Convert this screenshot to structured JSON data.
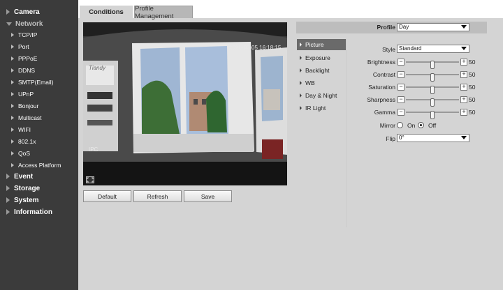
{
  "sidebar": {
    "camera": "Camera",
    "network": "Network",
    "items": [
      "TCP/IP",
      "Port",
      "PPPoE",
      "DDNS",
      "SMTP(Email)",
      "UPnP",
      "Bonjour",
      "Multicast",
      "WIFI",
      "802.1x",
      "QoS",
      "Access Platform"
    ],
    "event": "Event",
    "storage": "Storage",
    "system": "System",
    "information": "Information"
  },
  "tabs": {
    "conditions": "Conditions",
    "profile_management": "Profile Management"
  },
  "video": {
    "timestamp": "2020-07-05 16:18:15",
    "channel": "IPC",
    "wall_text": "Tiandy"
  },
  "buttons": {
    "default": "Default",
    "refresh": "Refresh",
    "save": "Save"
  },
  "profile": {
    "label": "Profile",
    "value": "Day"
  },
  "submenu": {
    "items": [
      "Picture",
      "Exposure",
      "Backlight",
      "WB",
      "Day & Night",
      "IR Light"
    ],
    "active": "Picture"
  },
  "settings": {
    "style_label": "Style",
    "style_value": "Standard",
    "sliders": [
      {
        "label": "Brightness",
        "value": 50
      },
      {
        "label": "Contrast",
        "value": 50
      },
      {
        "label": "Saturation",
        "value": 50
      },
      {
        "label": "Sharpness",
        "value": 50
      },
      {
        "label": "Gamma",
        "value": 50
      }
    ],
    "mirror_label": "Mirror",
    "mirror_on": "On",
    "mirror_off": "Off",
    "mirror_selected": "Off",
    "flip_label": "Flip",
    "flip_value": "0°"
  },
  "colors": {
    "sidebar_bg": "#3b3b3b",
    "panel_bg": "#d4d4d4",
    "active_sub": "#6a6a6a"
  }
}
